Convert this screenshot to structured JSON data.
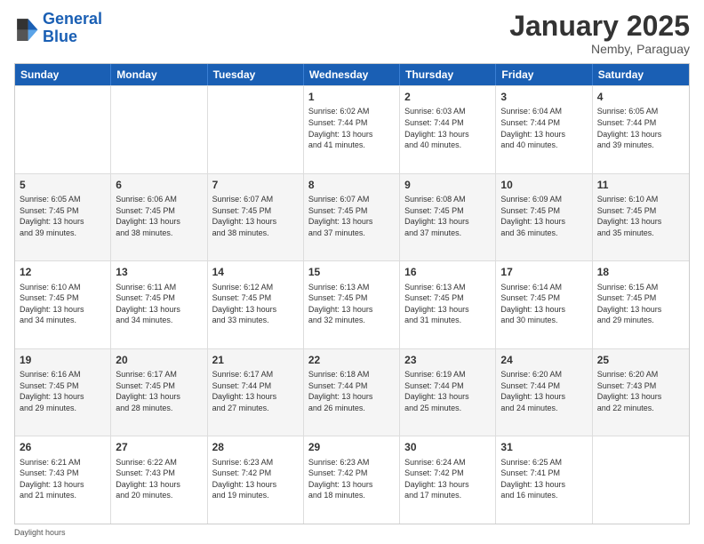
{
  "header": {
    "logo_line1": "General",
    "logo_line2": "Blue",
    "month_title": "January 2025",
    "location": "Nemby, Paraguay"
  },
  "days_of_week": [
    "Sunday",
    "Monday",
    "Tuesday",
    "Wednesday",
    "Thursday",
    "Friday",
    "Saturday"
  ],
  "footer_text": "Daylight hours",
  "weeks": [
    [
      {
        "day": "",
        "text": ""
      },
      {
        "day": "",
        "text": ""
      },
      {
        "day": "",
        "text": ""
      },
      {
        "day": "1",
        "text": "Sunrise: 6:02 AM\nSunset: 7:44 PM\nDaylight: 13 hours\nand 41 minutes."
      },
      {
        "day": "2",
        "text": "Sunrise: 6:03 AM\nSunset: 7:44 PM\nDaylight: 13 hours\nand 40 minutes."
      },
      {
        "day": "3",
        "text": "Sunrise: 6:04 AM\nSunset: 7:44 PM\nDaylight: 13 hours\nand 40 minutes."
      },
      {
        "day": "4",
        "text": "Sunrise: 6:05 AM\nSunset: 7:44 PM\nDaylight: 13 hours\nand 39 minutes."
      }
    ],
    [
      {
        "day": "5",
        "text": "Sunrise: 6:05 AM\nSunset: 7:45 PM\nDaylight: 13 hours\nand 39 minutes."
      },
      {
        "day": "6",
        "text": "Sunrise: 6:06 AM\nSunset: 7:45 PM\nDaylight: 13 hours\nand 38 minutes."
      },
      {
        "day": "7",
        "text": "Sunrise: 6:07 AM\nSunset: 7:45 PM\nDaylight: 13 hours\nand 38 minutes."
      },
      {
        "day": "8",
        "text": "Sunrise: 6:07 AM\nSunset: 7:45 PM\nDaylight: 13 hours\nand 37 minutes."
      },
      {
        "day": "9",
        "text": "Sunrise: 6:08 AM\nSunset: 7:45 PM\nDaylight: 13 hours\nand 37 minutes."
      },
      {
        "day": "10",
        "text": "Sunrise: 6:09 AM\nSunset: 7:45 PM\nDaylight: 13 hours\nand 36 minutes."
      },
      {
        "day": "11",
        "text": "Sunrise: 6:10 AM\nSunset: 7:45 PM\nDaylight: 13 hours\nand 35 minutes."
      }
    ],
    [
      {
        "day": "12",
        "text": "Sunrise: 6:10 AM\nSunset: 7:45 PM\nDaylight: 13 hours\nand 34 minutes."
      },
      {
        "day": "13",
        "text": "Sunrise: 6:11 AM\nSunset: 7:45 PM\nDaylight: 13 hours\nand 34 minutes."
      },
      {
        "day": "14",
        "text": "Sunrise: 6:12 AM\nSunset: 7:45 PM\nDaylight: 13 hours\nand 33 minutes."
      },
      {
        "day": "15",
        "text": "Sunrise: 6:13 AM\nSunset: 7:45 PM\nDaylight: 13 hours\nand 32 minutes."
      },
      {
        "day": "16",
        "text": "Sunrise: 6:13 AM\nSunset: 7:45 PM\nDaylight: 13 hours\nand 31 minutes."
      },
      {
        "day": "17",
        "text": "Sunrise: 6:14 AM\nSunset: 7:45 PM\nDaylight: 13 hours\nand 30 minutes."
      },
      {
        "day": "18",
        "text": "Sunrise: 6:15 AM\nSunset: 7:45 PM\nDaylight: 13 hours\nand 29 minutes."
      }
    ],
    [
      {
        "day": "19",
        "text": "Sunrise: 6:16 AM\nSunset: 7:45 PM\nDaylight: 13 hours\nand 29 minutes."
      },
      {
        "day": "20",
        "text": "Sunrise: 6:17 AM\nSunset: 7:45 PM\nDaylight: 13 hours\nand 28 minutes."
      },
      {
        "day": "21",
        "text": "Sunrise: 6:17 AM\nSunset: 7:44 PM\nDaylight: 13 hours\nand 27 minutes."
      },
      {
        "day": "22",
        "text": "Sunrise: 6:18 AM\nSunset: 7:44 PM\nDaylight: 13 hours\nand 26 minutes."
      },
      {
        "day": "23",
        "text": "Sunrise: 6:19 AM\nSunset: 7:44 PM\nDaylight: 13 hours\nand 25 minutes."
      },
      {
        "day": "24",
        "text": "Sunrise: 6:20 AM\nSunset: 7:44 PM\nDaylight: 13 hours\nand 24 minutes."
      },
      {
        "day": "25",
        "text": "Sunrise: 6:20 AM\nSunset: 7:43 PM\nDaylight: 13 hours\nand 22 minutes."
      }
    ],
    [
      {
        "day": "26",
        "text": "Sunrise: 6:21 AM\nSunset: 7:43 PM\nDaylight: 13 hours\nand 21 minutes."
      },
      {
        "day": "27",
        "text": "Sunrise: 6:22 AM\nSunset: 7:43 PM\nDaylight: 13 hours\nand 20 minutes."
      },
      {
        "day": "28",
        "text": "Sunrise: 6:23 AM\nSunset: 7:42 PM\nDaylight: 13 hours\nand 19 minutes."
      },
      {
        "day": "29",
        "text": "Sunrise: 6:23 AM\nSunset: 7:42 PM\nDaylight: 13 hours\nand 18 minutes."
      },
      {
        "day": "30",
        "text": "Sunrise: 6:24 AM\nSunset: 7:42 PM\nDaylight: 13 hours\nand 17 minutes."
      },
      {
        "day": "31",
        "text": "Sunrise: 6:25 AM\nSunset: 7:41 PM\nDaylight: 13 hours\nand 16 minutes."
      },
      {
        "day": "",
        "text": ""
      }
    ]
  ]
}
